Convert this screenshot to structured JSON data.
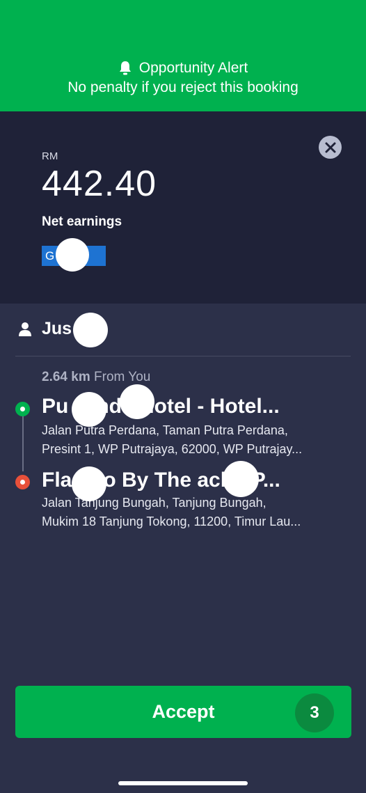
{
  "alert": {
    "icon": "bell-icon",
    "title": "Opportunity Alert",
    "subtitle": "No penalty if you reject this booking",
    "color": "#00b14f"
  },
  "earnings": {
    "currency": "RM",
    "amount": "442.40",
    "label": "Net earnings",
    "payment_badge": "G    ay",
    "close_icon": "close-icon"
  },
  "passenger": {
    "icon": "person-icon",
    "name": "Jus      ab"
  },
  "route": {
    "distance_value": "2.64 km",
    "distance_suffix": "From You",
    "pickup": {
      "name": "Pu        G      nde Hotel - Hotel...",
      "address_line1": "Jalan Putra Perdana, Taman Putra Perdana,",
      "address_line2": "Presint 1, WP Putrajaya, 62000, WP Putrajay..."
    },
    "dropoff": {
      "name": "Fla       ngo By The       ach - P...",
      "address_line1": "Jalan Tanjung Bungah, Tanjung Bungah,",
      "address_line2": "Mukim 18 Tanjung Tokong, 11200, Timur Lau..."
    }
  },
  "actions": {
    "accept_label": "Accept",
    "countdown": "3",
    "accept_color": "#00b14f"
  }
}
